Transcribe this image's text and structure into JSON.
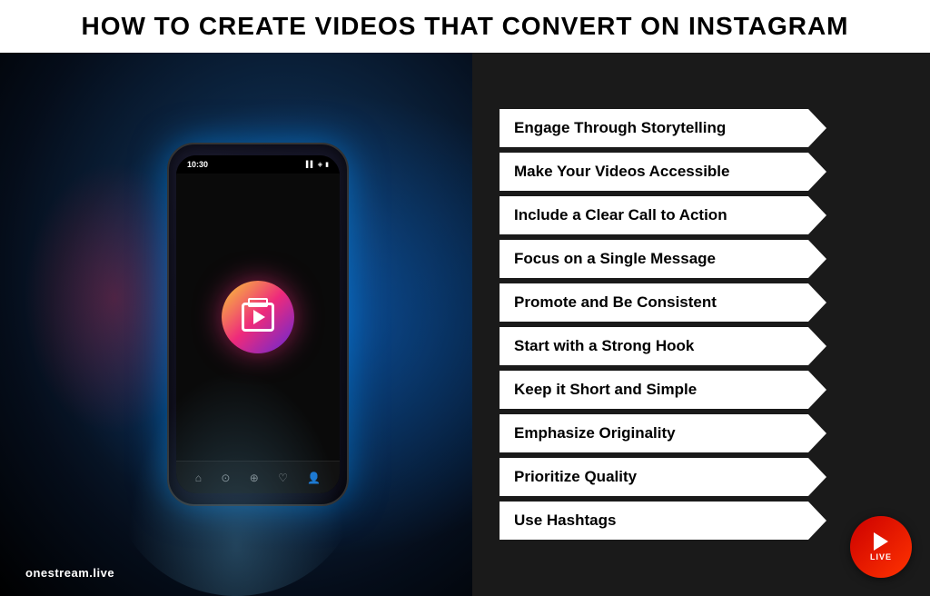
{
  "header": {
    "title": "HOW TO CREATE VIDEOS THAT CONVERT ON INSTAGRAM"
  },
  "brand": {
    "name": "onestream.live",
    "live_label": "LIVE"
  },
  "phone": {
    "time": "10:30",
    "signal_icons": "▌▌ ✦ 🔋"
  },
  "list_items": [
    {
      "id": 1,
      "label": "Engage Through Storytelling"
    },
    {
      "id": 2,
      "label": "Make Your Videos Accessible"
    },
    {
      "id": 3,
      "label": "Include a Clear Call to Action"
    },
    {
      "id": 4,
      "label": "Focus on a Single Message"
    },
    {
      "id": 5,
      "label": "Promote and Be Consistent"
    },
    {
      "id": 6,
      "label": "Start with a Strong Hook"
    },
    {
      "id": 7,
      "label": "Keep it Short and Simple"
    },
    {
      "id": 8,
      "label": "Emphasize Originality"
    },
    {
      "id": 9,
      "label": "Prioritize Quality"
    },
    {
      "id": 10,
      "label": "Use Hashtags"
    }
  ]
}
